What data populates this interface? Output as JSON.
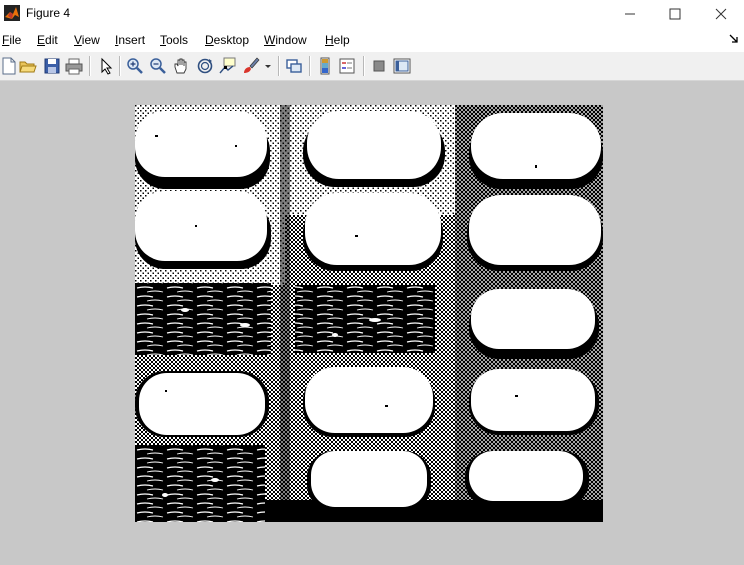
{
  "window": {
    "title": "Figure 4"
  },
  "menus": [
    {
      "underlined": "F",
      "rest": "ile"
    },
    {
      "underlined": "E",
      "rest": "dit"
    },
    {
      "underlined": "V",
      "rest": "iew"
    },
    {
      "underlined": "I",
      "rest": "nsert"
    },
    {
      "underlined": "T",
      "rest": "ools"
    },
    {
      "underlined": "D",
      "rest": "esktop"
    },
    {
      "underlined": "W",
      "rest": "indow"
    },
    {
      "underlined": "H",
      "rest": "elp"
    }
  ],
  "toolbar": {
    "icons": [
      "new-figure-icon",
      "open-file-icon",
      "save-icon",
      "print-icon",
      "edit-plot-arrow-icon",
      "zoom-in-icon",
      "zoom-out-icon",
      "pan-hand-icon",
      "rotate-3d-icon",
      "data-cursor-icon",
      "brush-icon",
      "brush-dropdown-icon",
      "link-plot-icon",
      "colorbar-icon",
      "legend-icon",
      "hide-plot-tools-icon",
      "show-plot-tools-icon"
    ]
  },
  "image": {
    "description_color_scheme": [
      "#000000",
      "#ffffff"
    ]
  }
}
